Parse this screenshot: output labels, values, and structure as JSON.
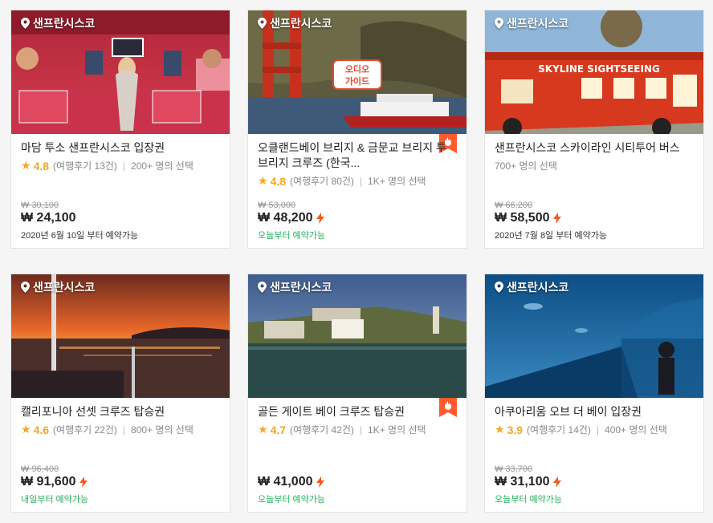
{
  "cards": [
    {
      "location": "샌프란시스코",
      "title": "마담 투소 샌프란시스코 입장권",
      "rating": "4.8",
      "reviews": "(여행후기 13건)",
      "chosen": "200+ 명의 선택",
      "old_price": "₩ 30,100",
      "price": "₩ 24,100",
      "availability": "2020년 6월 10일 부터 예약가능",
      "avail_green": false,
      "instant": false,
      "hot": false,
      "photo": "wax-museum"
    },
    {
      "location": "샌프란시스코",
      "title": "오클랜드베이 브리지 & 금문교 브리지 투 브리지 크루즈 (한국...",
      "rating": "4.8",
      "reviews": "(여행후기 80건)",
      "chosen": "1K+ 명의 선택",
      "old_price": "₩ 53,000",
      "price": "₩ 48,200",
      "availability": "오늘부터 예약가능",
      "avail_green": true,
      "instant": true,
      "hot": true,
      "photo": "bridge-cruise",
      "overlay_text_1": "오디오",
      "overlay_text_2": "가이드"
    },
    {
      "location": "샌프란시스코",
      "title": "샌프란시스코 스카이라인 시티투어 버스",
      "rating": "",
      "reviews": "",
      "chosen": "700+ 명의 선택",
      "old_price": "₩ 66,200",
      "price": "₩ 58,500",
      "availability": "2020년 7월 8일 부터 예약가능",
      "avail_green": false,
      "instant": true,
      "hot": false,
      "photo": "tour-bus",
      "overlay_text_1": "SKYLINE SIGHTSEEING"
    },
    {
      "location": "샌프란시스코",
      "title": "캘리포니아 선셋 크루즈 탑승권",
      "rating": "4.6",
      "reviews": "(여행후기 22건)",
      "chosen": "800+ 명의 선택",
      "old_price": "₩ 96,400",
      "price": "₩ 91,600",
      "availability": "내일부터 예약가능",
      "avail_green": true,
      "instant": true,
      "hot": false,
      "photo": "sunset"
    },
    {
      "location": "샌프란시스코",
      "title": "골든 게이트 베이 크루즈 탑승권",
      "rating": "4.7",
      "reviews": "(여행후기 42건)",
      "chosen": "1K+ 명의 선택",
      "old_price": "",
      "price": "₩ 41,000",
      "availability": "오늘부터 예약가능",
      "avail_green": true,
      "instant": true,
      "hot": true,
      "photo": "alcatraz"
    },
    {
      "location": "샌프란시스코",
      "title": "아쿠아리움 오브 더 베이 입장권",
      "rating": "3.9",
      "reviews": "(여행후기 14건)",
      "chosen": "400+ 명의 선택",
      "old_price": "₩ 33,700",
      "price": "₩ 31,100",
      "availability": "오늘부터 예약가능",
      "avail_green": true,
      "instant": true,
      "hot": false,
      "photo": "aquarium"
    }
  ],
  "colors": {
    "star": "#f5a623",
    "instant": "#f25a1e",
    "hot_badge": "#ff5b2e",
    "available": "#26b05f"
  }
}
